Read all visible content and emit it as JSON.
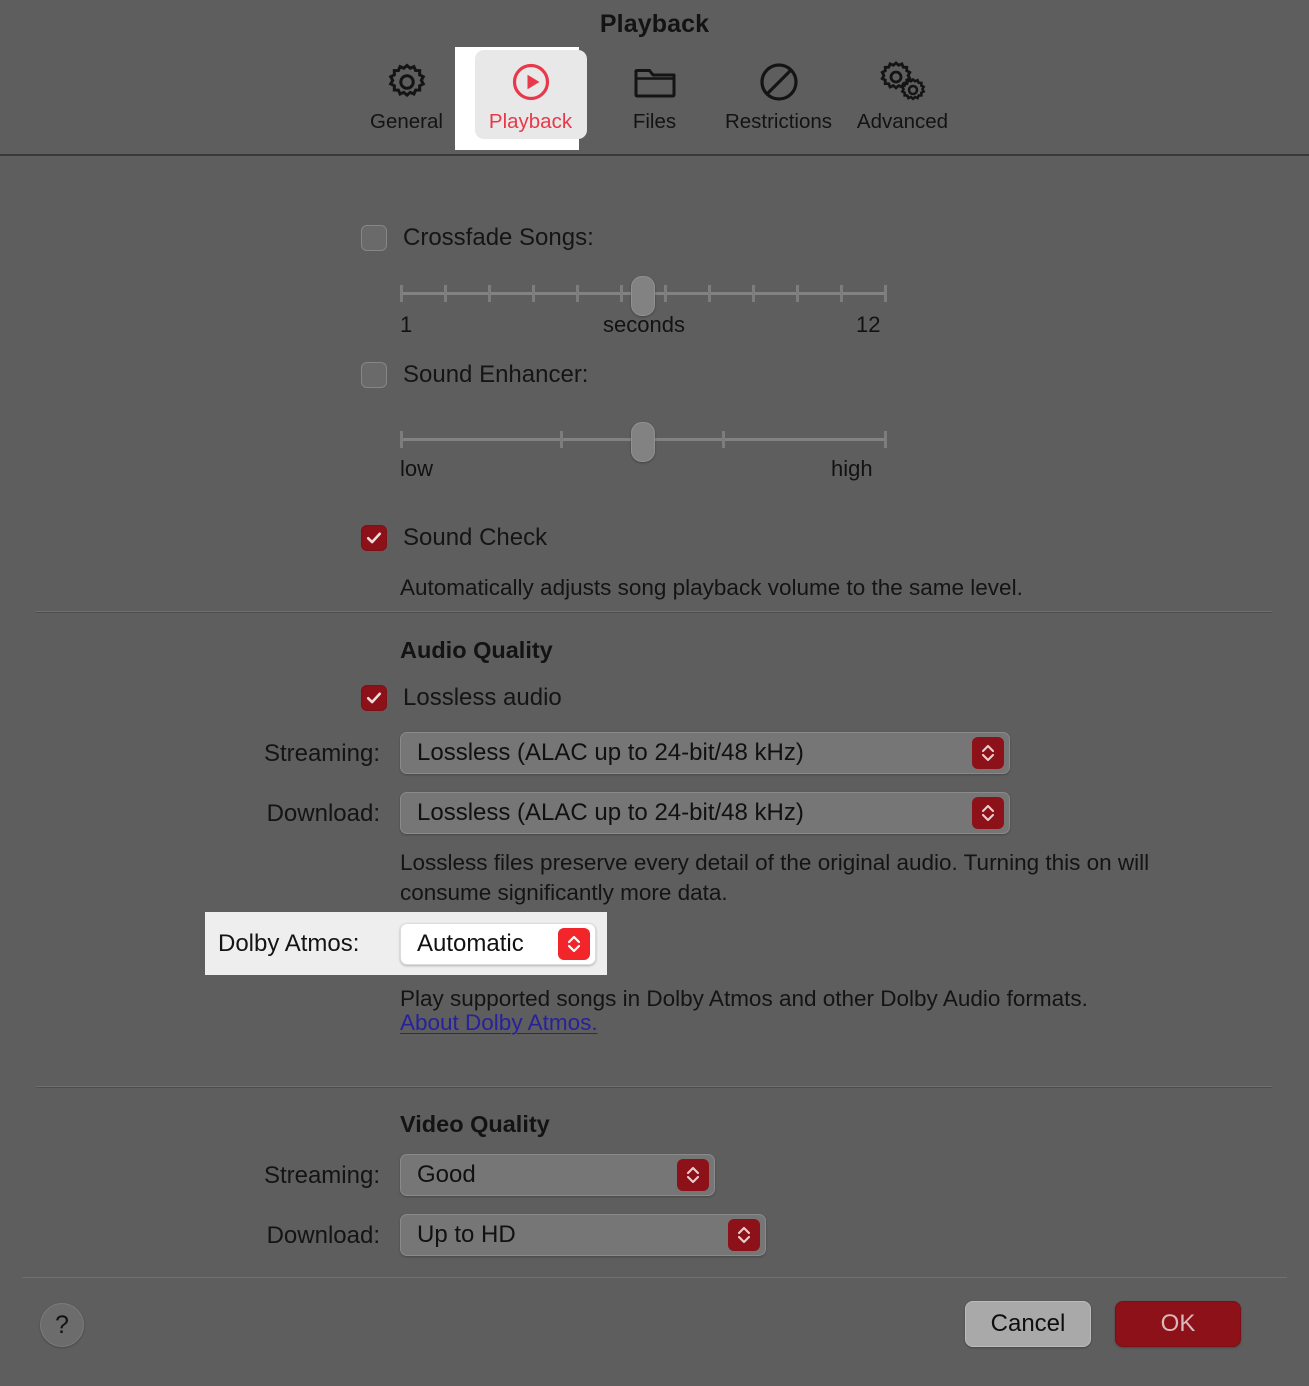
{
  "window": {
    "title": "Playback"
  },
  "toolbar": {
    "tabs": [
      {
        "label": "General",
        "icon": "gear-icon",
        "selected": false
      },
      {
        "label": "Playback",
        "icon": "play-circle-icon",
        "selected": true
      },
      {
        "label": "Files",
        "icon": "folder-icon",
        "selected": false
      },
      {
        "label": "Restrictions",
        "icon": "no-entry-icon",
        "selected": false
      },
      {
        "label": "Advanced",
        "icon": "gears-icon",
        "selected": false
      }
    ]
  },
  "playback": {
    "crossfade": {
      "label": "Crossfade Songs:",
      "checked": false,
      "slider": {
        "min_label": "1",
        "unit_label": "seconds",
        "max_label": "12",
        "ticks": 12,
        "value": 6,
        "min": 1,
        "max": 12
      }
    },
    "sound_enhancer": {
      "label": "Sound Enhancer:",
      "checked": false,
      "slider": {
        "min_label": "low",
        "max_label": "high",
        "ticks": 4,
        "value_percent": 50
      }
    },
    "sound_check": {
      "label": "Sound Check",
      "checked": true,
      "description": "Automatically adjusts song playback volume to the same level."
    }
  },
  "audio_quality": {
    "heading": "Audio Quality",
    "lossless": {
      "label": "Lossless audio",
      "checked": true
    },
    "streaming": {
      "label": "Streaming:",
      "value": "Lossless (ALAC up to 24-bit/48 kHz)"
    },
    "download": {
      "label": "Download:",
      "value": "Lossless (ALAC up to 24-bit/48 kHz)"
    },
    "description": "Lossless files preserve every detail of the original audio. Turning this on will consume significantly more data.",
    "dolby_atmos": {
      "label": "Dolby Atmos:",
      "value": "Automatic",
      "description": "Play supported songs in Dolby Atmos and other Dolby Audio formats.",
      "link_text": "About Dolby Atmos.",
      "highlighted": true
    }
  },
  "video_quality": {
    "heading": "Video Quality",
    "streaming": {
      "label": "Streaming:",
      "value": "Good"
    },
    "download": {
      "label": "Download:",
      "value": "Up to HD"
    }
  },
  "footer": {
    "help_label": "?",
    "cancel_label": "Cancel",
    "ok_label": "OK"
  },
  "colors": {
    "accent_red": "#e8394a",
    "control_red": "#8d1118",
    "bright_red": "#f2252b",
    "link_blue": "#27219c",
    "window_bg": "#5e5e5e",
    "highlight_white": "#eeeeee"
  }
}
